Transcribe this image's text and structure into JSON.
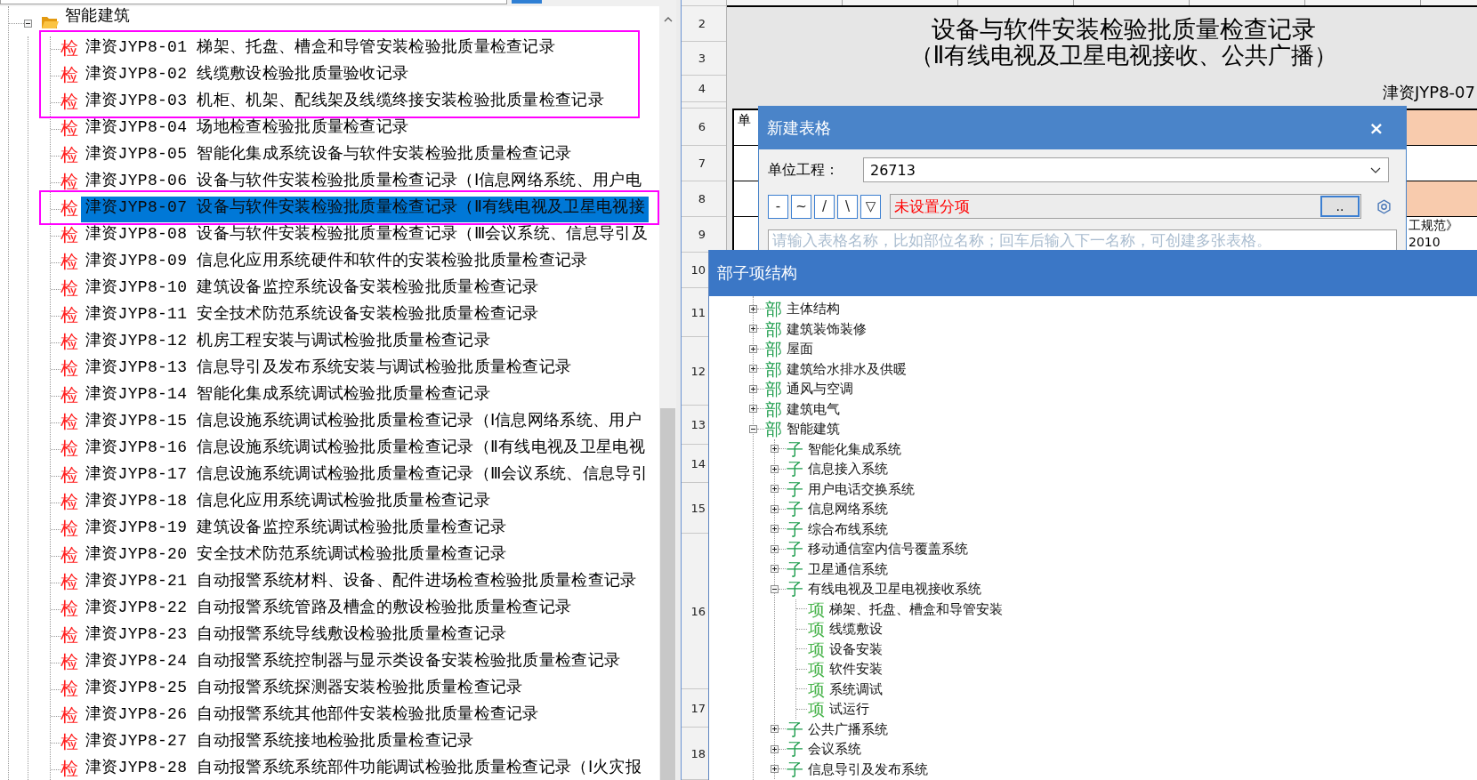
{
  "left_tree": {
    "root": {
      "label": "智能建筑",
      "expanded": true,
      "children": [
        {
          "tag": "检",
          "label": "津资JYP8-01 梯架、托盘、槽盒和导管安装检验批质量检查记录",
          "selected": false,
          "framed": true
        },
        {
          "tag": "检",
          "label": "津资JYP8-02 线缆敷设检验批质量验收记录",
          "selected": false,
          "framed": true
        },
        {
          "tag": "检",
          "label": "津资JYP8-03 机柜、机架、配线架及线缆终接安装检验批质量检查记录",
          "selected": false,
          "framed": true
        },
        {
          "tag": "检",
          "label": "津资JYP8-04 场地检查检验批质量检查记录",
          "selected": false,
          "framed": false
        },
        {
          "tag": "检",
          "label": "津资JYP8-05 智能化集成系统设备与软件安装检验批质量检查记录",
          "selected": false,
          "framed": false
        },
        {
          "tag": "检",
          "label": "津资JYP8-06 设备与软件安装检验批质量检查记录（Ⅰ信息网络系统、用户电",
          "selected": false,
          "framed": false
        },
        {
          "tag": "检",
          "label": "津资JYP8-07 设备与软件安装检验批质量检查记录（Ⅱ有线电视及卫星电视接",
          "selected": true,
          "framed": true
        },
        {
          "tag": "检",
          "label": "津资JYP8-08 设备与软件安装检验批质量检查记录（Ⅲ会议系统、信息导引及",
          "selected": false,
          "framed": false
        },
        {
          "tag": "检",
          "label": "津资JYP8-09 信息化应用系统硬件和软件的安装检验批质量检查记录",
          "selected": false,
          "framed": false
        },
        {
          "tag": "检",
          "label": "津资JYP8-10 建筑设备监控系统设备安装检验批质量检查记录",
          "selected": false,
          "framed": false
        },
        {
          "tag": "检",
          "label": "津资JYP8-11 安全技术防范系统设备安装检验批质量检查记录",
          "selected": false,
          "framed": false
        },
        {
          "tag": "检",
          "label": "津资JYP8-12 机房工程安装与调试检验批质量检查记录",
          "selected": false,
          "framed": false
        },
        {
          "tag": "检",
          "label": "津资JYP8-13 信息导引及发布系统安装与调试检验批质量检查记录",
          "selected": false,
          "framed": false
        },
        {
          "tag": "检",
          "label": "津资JYP8-14 智能化集成系统调试检验批质量检查记录",
          "selected": false,
          "framed": false
        },
        {
          "tag": "检",
          "label": "津资JYP8-15 信息设施系统调试检验批质量检查记录（Ⅰ信息网络系统、用户",
          "selected": false,
          "framed": false
        },
        {
          "tag": "检",
          "label": "津资JYP8-16 信息设施系统调试检验批质量检查记录（Ⅱ有线电视及卫星电视",
          "selected": false,
          "framed": false
        },
        {
          "tag": "检",
          "label": "津资JYP8-17 信息设施系统调试检验批质量检查记录（Ⅲ会议系统、信息导引",
          "selected": false,
          "framed": false
        },
        {
          "tag": "检",
          "label": "津资JYP8-18 信息化应用系统调试检验批质量检查记录",
          "selected": false,
          "framed": false
        },
        {
          "tag": "检",
          "label": "津资JYP8-19 建筑设备监控系统调试检验批质量检查记录",
          "selected": false,
          "framed": false
        },
        {
          "tag": "检",
          "label": "津资JYP8-20 安全技术防范系统调试检验批质量检查记录",
          "selected": false,
          "framed": false
        },
        {
          "tag": "检",
          "label": "津资JYP8-21 自动报警系统材料、设备、配件进场检查检验批质量检查记录",
          "selected": false,
          "framed": false
        },
        {
          "tag": "检",
          "label": "津资JYP8-22 自动报警系统管路及槽盒的敷设检验批质量检查记录",
          "selected": false,
          "framed": false
        },
        {
          "tag": "检",
          "label": "津资JYP8-23 自动报警系统导线敷设检验批质量检查记录",
          "selected": false,
          "framed": false
        },
        {
          "tag": "检",
          "label": "津资JYP8-24 自动报警系统控制器与显示类设备安装检验批质量检查记录",
          "selected": false,
          "framed": false
        },
        {
          "tag": "检",
          "label": "津资JYP8-25 自动报警系统探测器安装检验批质量检查记录",
          "selected": false,
          "framed": false
        },
        {
          "tag": "检",
          "label": "津资JYP8-26 自动报警系统其他部件安装检验批质量检查记录",
          "selected": false,
          "framed": false
        },
        {
          "tag": "检",
          "label": "津资JYP8-27 自动报警系统接地检验批质量检查记录",
          "selected": false,
          "framed": false
        },
        {
          "tag": "检",
          "label": "津资JYP8-28 自动报警系统系统部件功能调试检验批质量检查记录（Ⅰ火灾报",
          "selected": false,
          "framed": false
        }
      ]
    }
  },
  "sheet": {
    "row_numbers": [
      "2",
      "3",
      "4",
      "6",
      "7",
      "8",
      "9",
      "10",
      "11",
      "12",
      "13",
      "14",
      "15",
      "16",
      "17",
      "18"
    ],
    "title": "设备与软件安装检验批质量检查记录",
    "subtitle": "（Ⅱ有线电视及卫星电视接收、公共广播）",
    "code": "津资JYP8-07",
    "table_rows": [
      {
        "label": "单",
        "color": "#f8cbad"
      },
      {
        "color": "#ffffff"
      },
      {
        "color": "#f8cbad"
      },
      {
        "color": "#ffffff",
        "note_lines": [
          "工规范》",
          "2010"
        ]
      }
    ]
  },
  "new_table_dialog": {
    "title": "新建表格",
    "close": "×",
    "unit_project": {
      "label": "单位工程：",
      "value": "26713"
    },
    "symbol_buttons": [
      "-",
      "~",
      "/",
      "\\",
      "▽"
    ],
    "subitem": {
      "value": "未设置分项",
      "browse": ".."
    },
    "name_field": {
      "placeholder": "请输入表格名称，比如部位名称；回车后输入下一名称，可创建多张表格。"
    }
  },
  "structure_dialog": {
    "title": "部子项结构",
    "tree": [
      {
        "tag": "部",
        "label": "主体结构",
        "expanded": false
      },
      {
        "tag": "部",
        "label": "建筑装饰装修",
        "expanded": false
      },
      {
        "tag": "部",
        "label": "屋面",
        "expanded": false
      },
      {
        "tag": "部",
        "label": "建筑给水排水及供暖",
        "expanded": false
      },
      {
        "tag": "部",
        "label": "通风与空调",
        "expanded": false
      },
      {
        "tag": "部",
        "label": "建筑电气",
        "expanded": false
      },
      {
        "tag": "部",
        "label": "智能建筑",
        "expanded": true,
        "children": [
          {
            "tag": "子",
            "label": "智能化集成系统",
            "expanded": false
          },
          {
            "tag": "子",
            "label": "信息接入系统",
            "expanded": false
          },
          {
            "tag": "子",
            "label": "用户电话交换系统",
            "expanded": false
          },
          {
            "tag": "子",
            "label": "信息网络系统",
            "expanded": false
          },
          {
            "tag": "子",
            "label": "综合布线系统",
            "expanded": false
          },
          {
            "tag": "子",
            "label": "移动通信室内信号覆盖系统",
            "expanded": false
          },
          {
            "tag": "子",
            "label": "卫星通信系统",
            "expanded": false
          },
          {
            "tag": "子",
            "label": "有线电视及卫星电视接收系统",
            "expanded": true,
            "children": [
              {
                "tag": "项",
                "label": "梯架、托盘、槽盒和导管安装"
              },
              {
                "tag": "项",
                "label": "线缆敷设"
              },
              {
                "tag": "项",
                "label": "设备安装"
              },
              {
                "tag": "项",
                "label": "软件安装"
              },
              {
                "tag": "项",
                "label": "系统调试"
              },
              {
                "tag": "项",
                "label": "试运行"
              }
            ]
          },
          {
            "tag": "子",
            "label": "公共广播系统",
            "expanded": false
          },
          {
            "tag": "子",
            "label": "会议系统",
            "expanded": false
          },
          {
            "tag": "子",
            "label": "信息导引及发布系统",
            "expanded": false
          }
        ]
      }
    ]
  }
}
